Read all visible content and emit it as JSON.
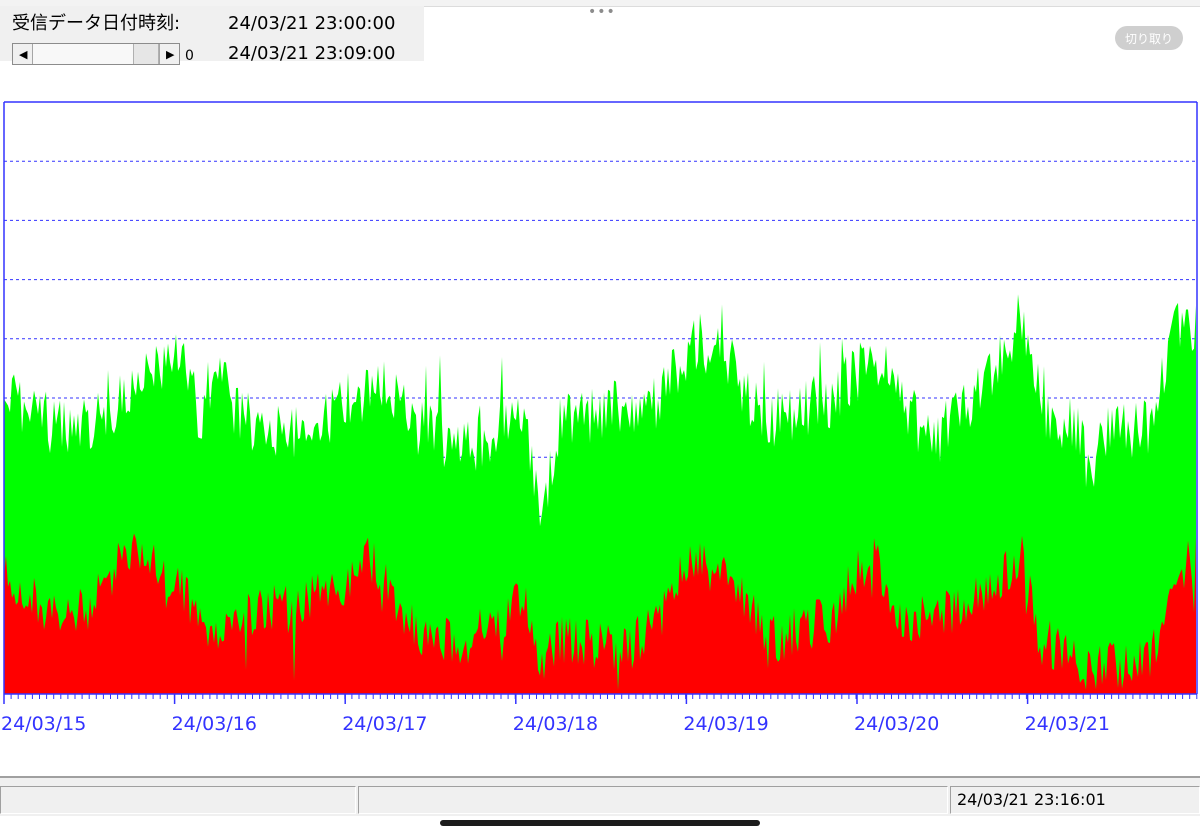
{
  "header": {
    "received_label": "受信データ日付時刻:",
    "received_time_1": "24/03/21 23:00:00",
    "received_time_2": "24/03/21 23:09:00",
    "scroll_value": "0",
    "scroll_left_glyph": "◀",
    "scroll_right_glyph": "▶",
    "more_dots": "•••",
    "crop_button_label": "切り取り"
  },
  "chart_data": {
    "type": "area",
    "x_ticks": [
      "24/03/15",
      "24/03/16",
      "24/03/17",
      "24/03/18",
      "24/03/19",
      "24/03/20",
      "24/03/21"
    ],
    "horizontal_gridlines": 9,
    "grid_style": "dashed",
    "series": [
      {
        "color": "#00ff00"
      },
      {
        "color": "#ff0000"
      }
    ],
    "frame_color": "#3333ff",
    "tick_label_color": "#3333ff"
  },
  "status_bar": {
    "timestamp": "24/03/21 23:16:01"
  }
}
